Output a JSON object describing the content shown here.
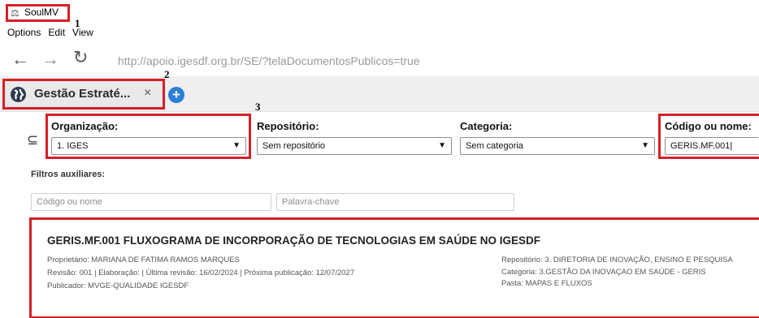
{
  "window": {
    "app_title": "SoulMV",
    "app_icon": "soulmv-icon"
  },
  "menu": {
    "items": [
      "Options",
      "Edit",
      "View"
    ]
  },
  "browser": {
    "url": "http://apoio.igesdf.org.br/SE/?telaDocumentosPublicos=true",
    "tab": {
      "label": "Gestão Estraté...",
      "close": "×"
    },
    "add_tab": "+"
  },
  "callouts": {
    "one": "1",
    "two": "2",
    "three": "3"
  },
  "filters": {
    "organizacao": {
      "label": "Organização:",
      "value": "1. IGES"
    },
    "repositorio": {
      "label": "Repositório:",
      "value": "Sem repositório"
    },
    "categoria": {
      "label": "Categoria:",
      "value": "Sem categoria"
    },
    "codigo": {
      "label": "Código ou nome:",
      "value": "GERIS.MF.001"
    },
    "aux_title": "Filtros auxiliares:",
    "aux_code_placeholder": "Código ou nome",
    "aux_keyword_placeholder": "Palavra-chave"
  },
  "result": {
    "title": "GERIS.MF.001 FLUXOGRAMA DE INCORPORAÇÃO DE TECNOLOGIAS EM SAÚDE NO IGESDF",
    "owner": "Proprietário: MARIANA DE FATIMA RAMOS MARQUES",
    "revision_line": "Revisão: 001  |  Elaboração:  |  Última revisão: 16/02/2024  |  Próxima publicação: 12/07/2027",
    "publisher": "Publicador: MVGE-QUALIDADE IGESDF",
    "repository": "Repositório: 3. DIRETORIA DE INOVAÇÃO, ENSINO E PESQUISA",
    "category": "Categoria: 3.GESTÃO DA INOVAÇAO EM SAÚDE - GERIS",
    "folder": "Pasta: MAPAS E FLUXOS"
  },
  "colors": {
    "highlight": "#d61f26",
    "accent": "#2c80d8"
  }
}
